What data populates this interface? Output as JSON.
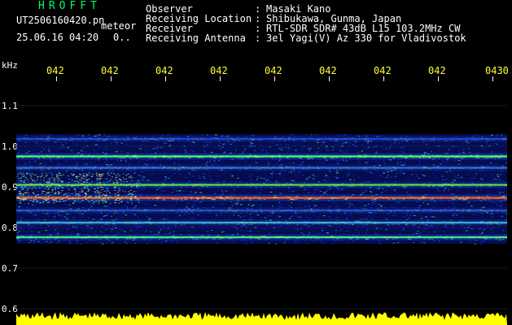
{
  "header": {
    "app_title": "HROFFT",
    "file_name": "UT2506160420.pn",
    "file_tag": "meteor",
    "timestamp": "25.06.16 04:20",
    "value_readout": "0.."
  },
  "info": [
    {
      "label": "Observer",
      "value": "Masaki Kano"
    },
    {
      "label": "Receiving Location",
      "value": "Shibukawa, Gunma, Japan"
    },
    {
      "label": "Receiver",
      "value": "RTL-SDR SDR# 43dB L15 103.2MHz CW"
    },
    {
      "label": "Receiving Antenna",
      "value": "3el Yagi(V) Az 330 for Vladivostok"
    }
  ],
  "colon": ":",
  "chart_data": {
    "type": "heatmap",
    "ylabel": "kHz",
    "y_ticks": [
      "1.1",
      "1.0",
      "0.9",
      "0.8",
      "0.7",
      "0.6"
    ],
    "ylim": [
      0.6,
      1.1
    ],
    "x_ticks": [
      "042",
      "042",
      "042",
      "042",
      "042",
      "042",
      "042",
      "042",
      "0430"
    ],
    "bands": [
      {
        "freq": 1.018,
        "strength": 0.35,
        "color": "#3050ff"
      },
      {
        "freq": 0.975,
        "strength": 0.9,
        "color": "#40ff70"
      },
      {
        "freq": 0.947,
        "strength": 0.4,
        "color": "#4080ff"
      },
      {
        "freq": 0.905,
        "strength": 0.6,
        "color": "#60ff40"
      },
      {
        "freq": 0.873,
        "strength": 1.0,
        "color": "#ff5020"
      },
      {
        "freq": 0.842,
        "strength": 0.35,
        "color": "#3060ff"
      },
      {
        "freq": 0.812,
        "strength": 0.5,
        "color": "#40d0ff"
      },
      {
        "freq": 0.776,
        "strength": 0.7,
        "color": "#40ff90"
      }
    ],
    "noise_floor_color": "#ffff00",
    "background_band_color": "#0a1ab0"
  }
}
